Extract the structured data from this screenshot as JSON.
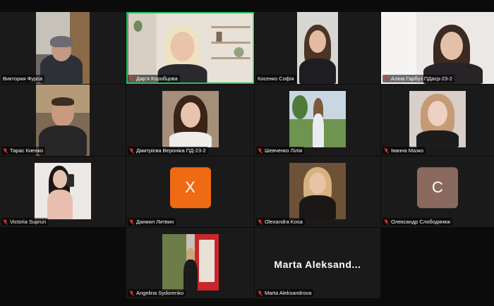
{
  "participants": [
    {
      "name": "Виктория Фурса",
      "muted": false
    },
    {
      "name": "Дар'я Коробцова",
      "muted": true,
      "active_speaker": true
    },
    {
      "name": "Косенко Софія",
      "muted": false
    },
    {
      "name": "Аліна Гарбуз ПДаср-23-2",
      "muted": true
    },
    {
      "name": "Тарас Киенко",
      "muted": true
    },
    {
      "name": "Дмитрієва Вероніка ПД-23-2",
      "muted": true
    },
    {
      "name": "Шевченко Лілія",
      "muted": true
    },
    {
      "name": "Іванна Мазко",
      "muted": true
    },
    {
      "name": "Victoria Suprun",
      "muted": true
    },
    {
      "name": "Даниил Литвин",
      "muted": true,
      "avatar_letter": "Х",
      "avatar_color": "#ee6a13"
    },
    {
      "name": "Olexandra Kosa",
      "muted": true
    },
    {
      "name": "Олександр Слободянюк",
      "muted": true,
      "avatar_letter": "С",
      "avatar_color": "#8a6a5f"
    },
    {
      "name": "Angelina Sydorenko",
      "muted": true
    },
    {
      "name": "Marta Aleksandrova",
      "muted": true,
      "display_name": "Marta  Aleksand..."
    }
  ],
  "colors": {
    "active_border": "#21c25b",
    "muted_icon": "#e0302e"
  }
}
